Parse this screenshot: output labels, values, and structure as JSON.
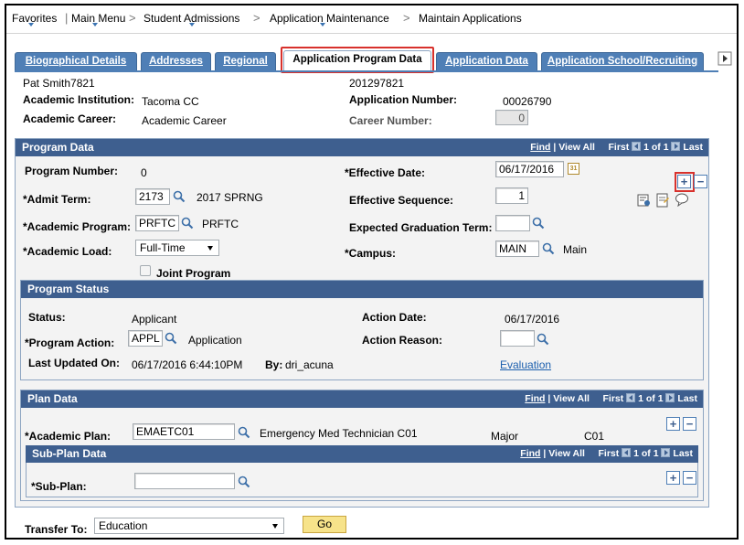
{
  "breadcrumb": {
    "items": [
      "Favorites",
      "Main Menu",
      "Student Admissions",
      "Application Maintenance",
      "Maintain Applications"
    ],
    "separator": ">"
  },
  "tabs": [
    {
      "label": "Biographical Details",
      "active": false
    },
    {
      "label": "Addresses",
      "active": false
    },
    {
      "label": "Regional",
      "active": false
    },
    {
      "label": "Application Program Data",
      "active": true
    },
    {
      "label": "Application Data",
      "active": false
    },
    {
      "label": "Application School/Recruiting",
      "active": false
    }
  ],
  "header": {
    "person_name": "Pat Smith7821",
    "person_id": "201297821",
    "institution_label": "Academic Institution:",
    "institution_value": "Tacoma CC",
    "app_number_label": "Application Number:",
    "app_number_value": "00026790",
    "career_label": "Academic Career:",
    "career_value": "Academic Career",
    "career_number_label": "Career Number:",
    "career_number_value": "0"
  },
  "program_data": {
    "title": "Program Data",
    "nav": {
      "find": "Find",
      "view_all": "View All",
      "first": "First",
      "count": "1 of 1",
      "last": "Last"
    },
    "program_number_label": "Program Number:",
    "program_number_value": "0",
    "effective_date_label": "*Effective Date:",
    "effective_date_value": "06/17/2016",
    "admit_term_label": "*Admit Term:",
    "admit_term_value": "2173",
    "admit_term_desc": "2017 SPRNG",
    "effective_sequence_label": "Effective Sequence:",
    "effective_sequence_value": "1",
    "academic_program_label": "*Academic Program:",
    "academic_program_value": "PRFTC",
    "academic_program_desc": "PRFTC",
    "expected_grad_label": "Expected Graduation Term:",
    "expected_grad_value": "",
    "academic_load_label": "*Academic Load:",
    "academic_load_value": "Full-Time",
    "campus_label": "*Campus:",
    "campus_value": "MAIN",
    "campus_desc": "Main",
    "joint_program_label": "Joint Program"
  },
  "program_status": {
    "title": "Program Status",
    "status_label": "Status:",
    "status_value": "Applicant",
    "action_date_label": "Action Date:",
    "action_date_value": "06/17/2016",
    "program_action_label": "*Program Action:",
    "program_action_value": "APPL",
    "program_action_desc": "Application",
    "action_reason_label": "Action Reason:",
    "action_reason_value": "",
    "last_updated_label": "Last Updated On:",
    "last_updated_value": "06/17/2016  6:44:10PM",
    "by_label": "By:",
    "by_value": "dri_acuna",
    "evaluation_link": "Evaluation"
  },
  "plan_data": {
    "title": "Plan Data",
    "nav": {
      "find": "Find",
      "view_all": "View All",
      "first": "First",
      "count": "1 of 1",
      "last": "Last"
    },
    "academic_plan_label": "*Academic Plan:",
    "academic_plan_value": "EMAETC01",
    "academic_plan_desc": "Emergency Med Technician C01",
    "plan_type": "Major",
    "plan_code": "C01"
  },
  "sub_plan_data": {
    "title": "Sub-Plan Data",
    "nav": {
      "find": "Find",
      "view_all": "View All",
      "first": "First",
      "count": "1 of 1",
      "last": "Last"
    },
    "sub_plan_label": "*Sub-Plan:",
    "sub_plan_value": ""
  },
  "footer": {
    "transfer_label": "Transfer To:",
    "transfer_value": "Education",
    "go_label": "Go"
  },
  "colors": {
    "tab_blue": "#4f7fb6",
    "section_header": "#3e5f8f",
    "highlight_red": "#d8312c",
    "link_blue": "#1c5fae"
  }
}
